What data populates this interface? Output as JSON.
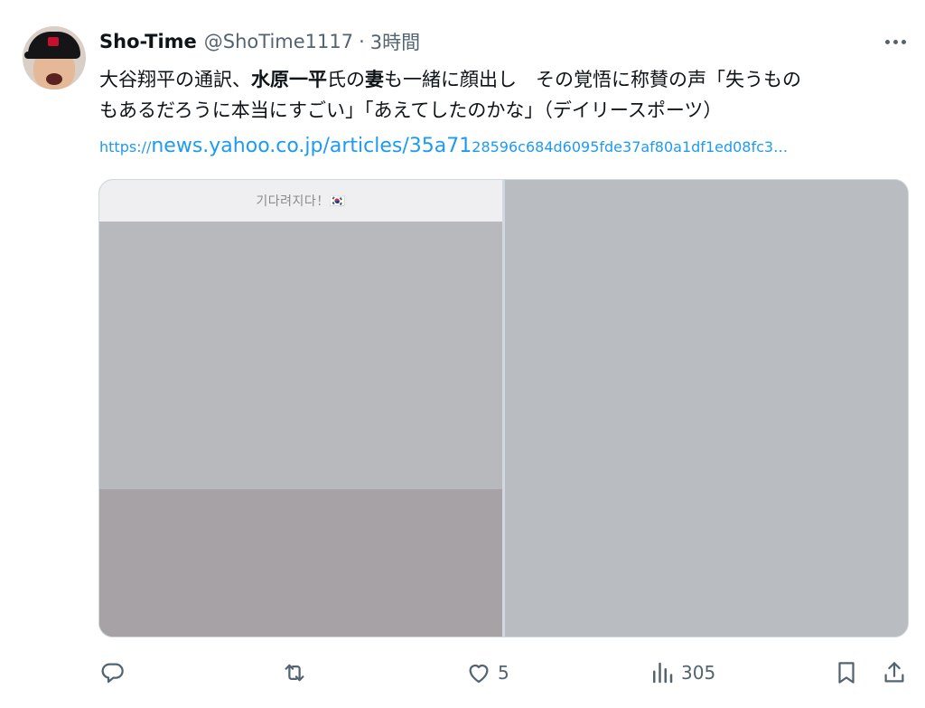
{
  "tweet": {
    "display_name": "Sho-Time",
    "handle": "@ShoTime1117",
    "separator": "·",
    "time": "3時間",
    "text_line1_a": "大谷翔平の通訳、",
    "text_line1_b": "水原一平",
    "text_line1_c": "氏の",
    "text_line1_d": "妻",
    "text_line1_e": "も一緒に顔出し　その覚悟に称賛の声「失うもの",
    "text_line2": "もあるだろうに本当にすごい」「あえてしたのかな」（デイリースポーツ）",
    "link_scheme": "https://",
    "link_text": "news.yahoo.co.jp/articles/35a71",
    "link_tail": "28596c684d6095fde37af80a1df1ed08fc3…"
  },
  "media": {
    "left_caption": "기다려지다！🇰🇷"
  },
  "actions": {
    "reply_icon": "reply-icon",
    "retweet_icon": "retweet-icon",
    "like_count": "5",
    "views_count": "305"
  }
}
